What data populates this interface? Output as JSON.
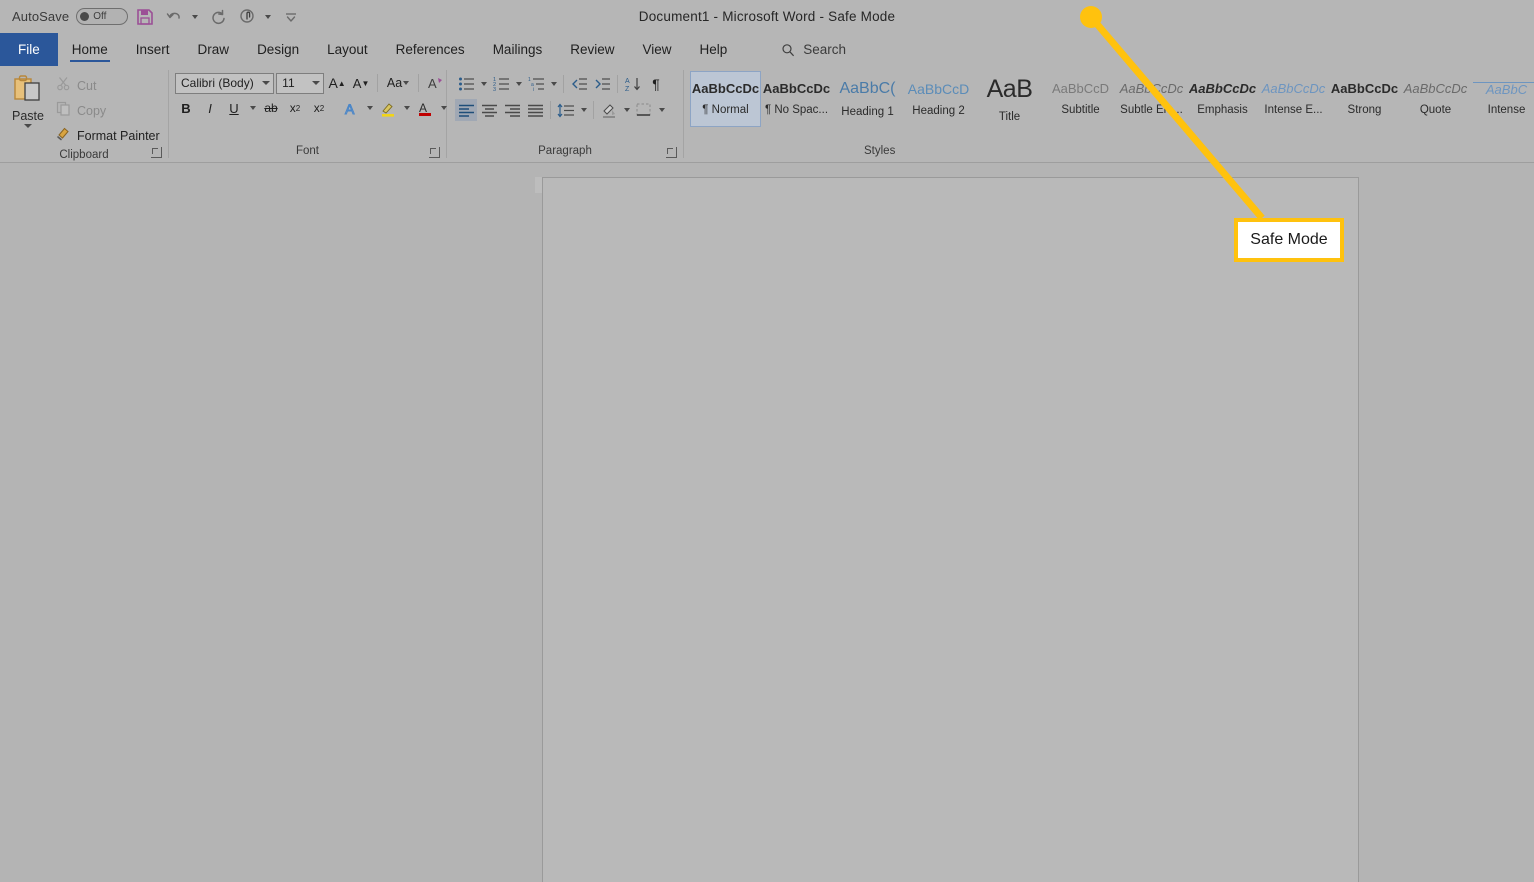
{
  "titlebar": {
    "autosave_label": "AutoSave",
    "autosave_state": "Off",
    "document_title": "Document1  -  Microsoft Word  -  Safe Mode",
    "quick_access": [
      {
        "name": "save-icon",
        "label": "Save"
      },
      {
        "name": "undo-icon",
        "label": "Undo"
      },
      {
        "name": "redo-icon",
        "label": "Redo"
      },
      {
        "name": "touch-mode-icon",
        "label": "Touch/Mouse Mode"
      },
      {
        "name": "customize-qat-icon",
        "label": "Customize Quick Access Toolbar"
      }
    ]
  },
  "tabs": [
    {
      "label": "File",
      "active": false,
      "file": true
    },
    {
      "label": "Home",
      "active": true
    },
    {
      "label": "Insert",
      "active": false
    },
    {
      "label": "Draw",
      "active": false
    },
    {
      "label": "Design",
      "active": false
    },
    {
      "label": "Layout",
      "active": false
    },
    {
      "label": "References",
      "active": false
    },
    {
      "label": "Mailings",
      "active": false
    },
    {
      "label": "Review",
      "active": false
    },
    {
      "label": "View",
      "active": false
    },
    {
      "label": "Help",
      "active": false
    }
  ],
  "search": {
    "label": "Search",
    "icon": "search-icon"
  },
  "ribbon": {
    "clipboard": {
      "group_label": "Clipboard",
      "paste_label": "Paste",
      "items": [
        {
          "label": "Cut",
          "icon": "scissors-icon",
          "enabled": false
        },
        {
          "label": "Copy",
          "icon": "copy-icon",
          "enabled": false
        },
        {
          "label": "Format Painter",
          "icon": "paintbrush-icon",
          "enabled": true
        }
      ]
    },
    "font": {
      "group_label": "Font",
      "font_name": "Calibri (Body)",
      "font_size": "11",
      "buttons": [
        {
          "label": "A",
          "name": "grow-font-button"
        },
        {
          "label": "A",
          "name": "shrink-font-button"
        },
        {
          "label": "Aa",
          "name": "change-case-button"
        },
        {
          "label": "A",
          "name": "clear-formatting-button"
        },
        {
          "label": "B",
          "name": "bold-button"
        },
        {
          "label": "I",
          "name": "italic-button"
        },
        {
          "label": "U",
          "name": "underline-button"
        },
        {
          "label": "ab",
          "name": "strikethrough-button"
        },
        {
          "label": "x",
          "name": "subscript-button"
        },
        {
          "label": "x",
          "name": "superscript-button"
        },
        {
          "label": "A",
          "name": "text-effects-button"
        },
        {
          "label": "",
          "name": "text-highlight-color-button"
        },
        {
          "label": "A",
          "name": "font-color-button"
        }
      ]
    },
    "paragraph": {
      "group_label": "Paragraph",
      "buttons": [
        {
          "name": "bullets-button"
        },
        {
          "name": "numbering-button"
        },
        {
          "name": "multilevel-list-button"
        },
        {
          "name": "decrease-indent-button"
        },
        {
          "name": "increase-indent-button"
        },
        {
          "name": "sort-button"
        },
        {
          "name": "show-formatting-marks-button"
        },
        {
          "name": "align-left-button"
        },
        {
          "name": "center-button"
        },
        {
          "name": "align-right-button"
        },
        {
          "name": "justify-button"
        },
        {
          "name": "line-spacing-button"
        },
        {
          "name": "shading-button"
        },
        {
          "name": "borders-button"
        }
      ]
    },
    "styles": {
      "group_label": "Styles",
      "items": [
        {
          "preview": "AaBbCcDc",
          "name": "¶ Normal",
          "selected": true,
          "cls": "sp-normal"
        },
        {
          "preview": "AaBbCcDc",
          "name": "¶ No Spac...",
          "selected": false,
          "cls": "sp-normal"
        },
        {
          "preview": "AaBbC(",
          "name": "Heading 1",
          "selected": false,
          "cls": "sp-h1"
        },
        {
          "preview": "AaBbCcD",
          "name": "Heading 2",
          "selected": false,
          "cls": "sp-h2"
        },
        {
          "preview": "AaB",
          "name": "Title",
          "selected": false,
          "cls": "sp-title"
        },
        {
          "preview": "AaBbCcD",
          "name": "Subtitle",
          "selected": false,
          "cls": "sp-sub"
        },
        {
          "preview": "AaBbCcDc",
          "name": "Subtle Em...",
          "selected": false,
          "cls": "sp-it"
        },
        {
          "preview": "AaBbCcDc",
          "name": "Emphasis",
          "selected": false,
          "cls": "sp-itb"
        },
        {
          "preview": "AaBbCcDc",
          "name": "Intense E...",
          "selected": false,
          "cls": "sp-blue-it"
        },
        {
          "preview": "AaBbCcDc",
          "name": "Strong",
          "selected": false,
          "cls": "sp-bold"
        },
        {
          "preview": "AaBbCcDc",
          "name": "Quote",
          "selected": false,
          "cls": "sp-it"
        },
        {
          "preview": "AaBbC",
          "name": "Intense",
          "selected": false,
          "cls": "sp-ul"
        }
      ]
    }
  },
  "annotation": {
    "callout_text": "Safe Mode",
    "accent_color": "#ffc20e",
    "callout_bg": "#ffffff"
  },
  "colors": {
    "ribbon_bg": "#b6b6b6",
    "workspace_bg": "#b4b4b4",
    "page_bg": "#b9b9b9",
    "file_tab_bg": "#2b579a",
    "accent": "#2b579a"
  }
}
